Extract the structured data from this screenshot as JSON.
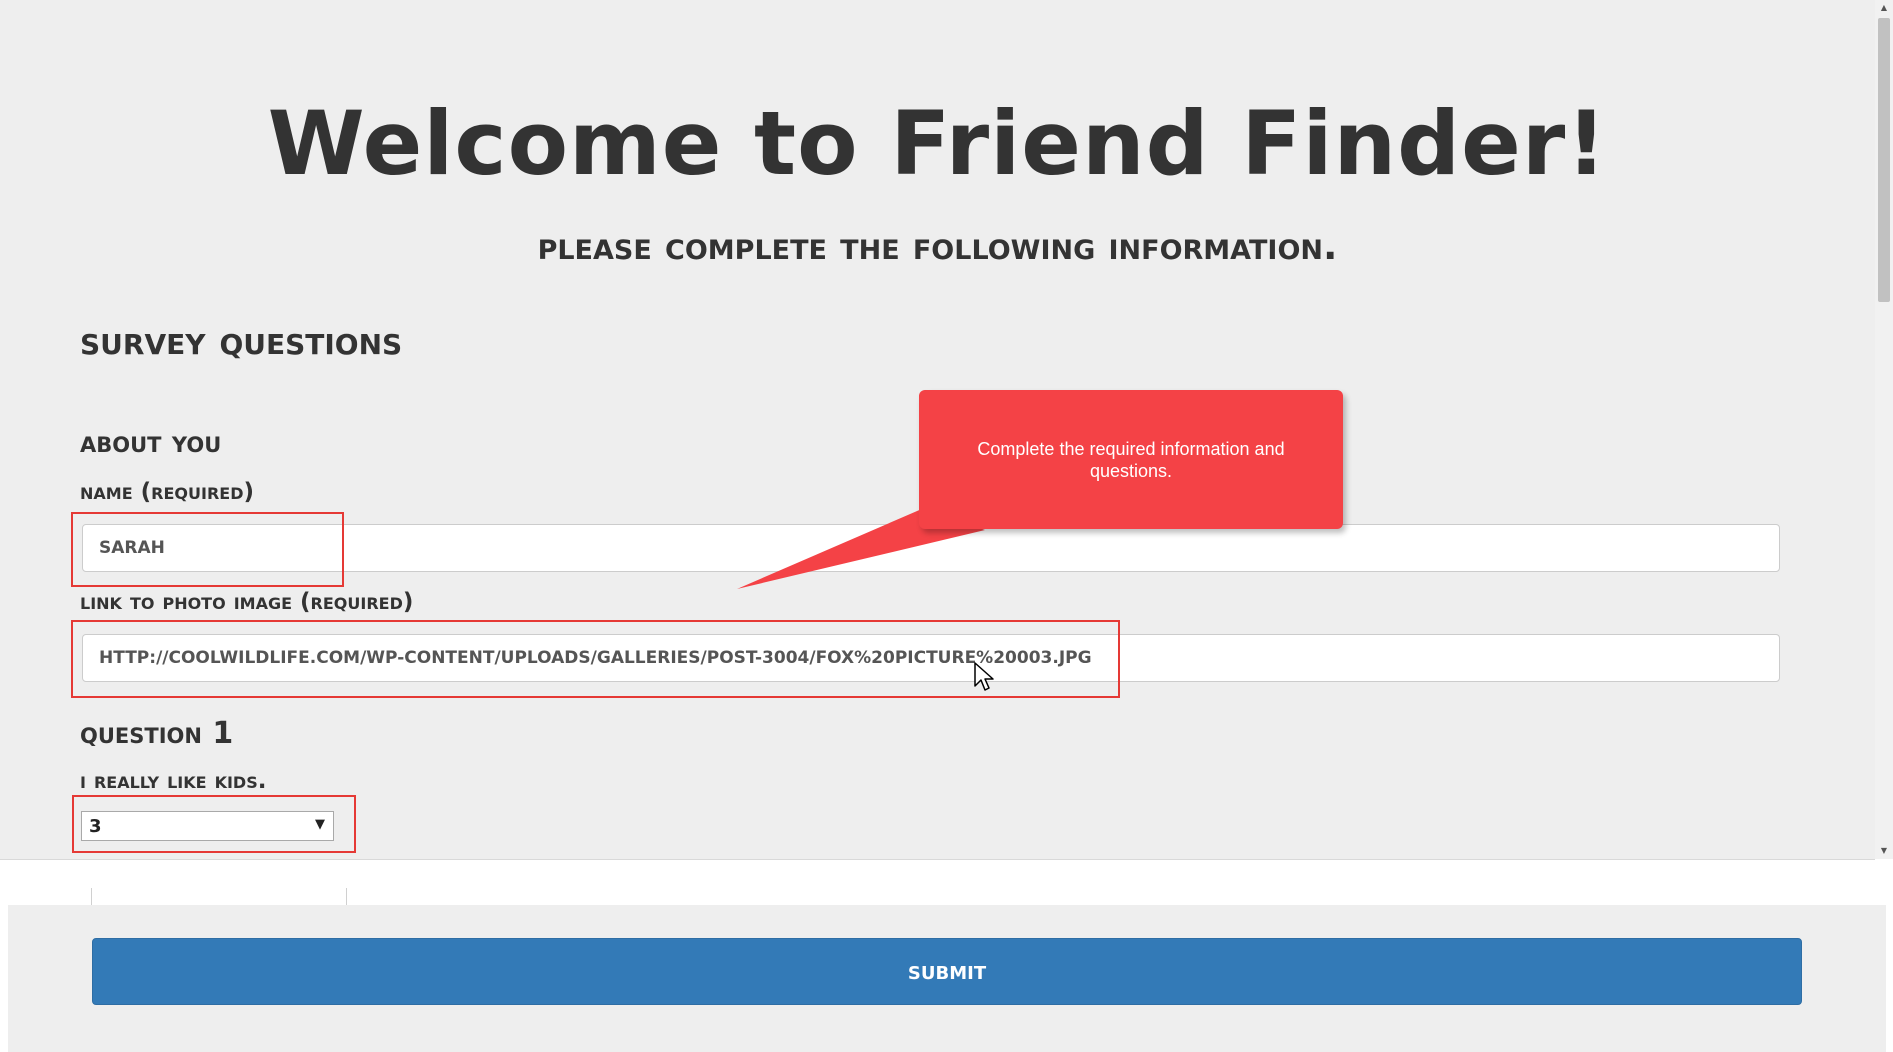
{
  "page": {
    "title": "Welcome to Friend Finder!",
    "subtitle": "Please complete the following information."
  },
  "survey": {
    "heading": "Survey Questions",
    "about_heading": "About You",
    "name_label": "Name (Required)",
    "name_value": "SARAH",
    "photo_label": "Link to Photo Image (Required)",
    "photo_value": "HTTP://COOLWILDLIFE.COM/WP-CONTENT/UPLOADS/GALLERIES/POST-3004/FOX%20PICTURE%20003.JPG",
    "question1_heading": "Question 1",
    "question1_text": "I really like kids.",
    "question1_selected": "3"
  },
  "callout": {
    "text": "Complete the required information and questions."
  },
  "footer": {
    "submit_label": "Submit"
  },
  "colors": {
    "callout": "#f44246",
    "highlight": "#e53935",
    "submit": "#337ab7",
    "background": "#eeeeee"
  },
  "icons": {
    "select_arrow": "triangle-down-icon",
    "cursor": "mouse-pointer-icon"
  }
}
